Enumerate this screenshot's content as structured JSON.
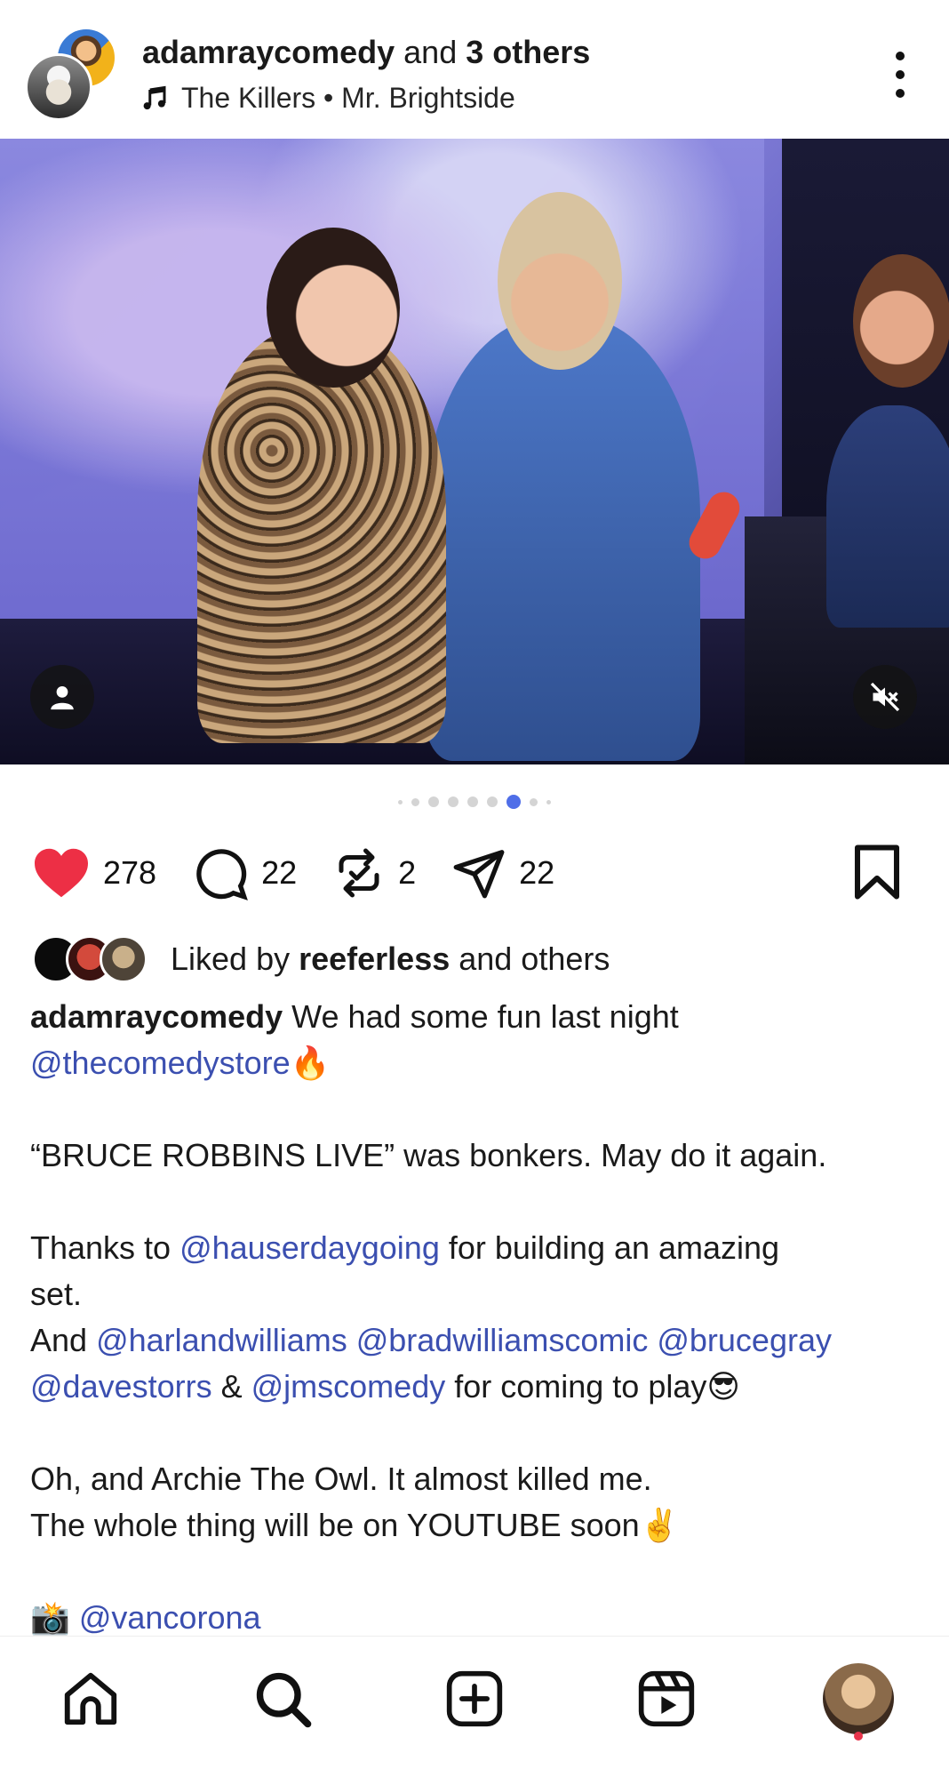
{
  "header": {
    "username": "adamraycomedy",
    "connector": " and ",
    "others": "3 others",
    "music_artist": "The Killers",
    "music_separator": " • ",
    "music_track": "Mr. Brightside"
  },
  "carousel": {
    "current_index": 6,
    "visible_dots": 9
  },
  "actions": {
    "likes_count": "278",
    "comments_count": "22",
    "reposts_count": "2",
    "shares_count": "22",
    "like_color": "#ed2f45"
  },
  "liked_by": {
    "prefix": "Liked by ",
    "user": "reeferless",
    "suffix": " and others"
  },
  "caption": {
    "user": "adamraycomedy",
    "line1_text": " We had some fun last night",
    "mention_store": "@thecomedystore",
    "emoji_fire": "🔥",
    "line_show": "“BRUCE ROBBINS LIVE” was bonkers. May do it again.",
    "thanks_prefix": "Thanks to ",
    "mention_hauser": "@hauserdaygoing",
    "thanks_suffix": " for building an amazing",
    "thanks_line2": "set.",
    "and_prefix": "And ",
    "mention_harland": "@harlandwilliams",
    "mention_brad": "@bradwilliamscomic",
    "mention_bruce": "@brucegray",
    "mention_dave": "@davestorrs",
    "amp": " & ",
    "mention_jms": "@jmscomedy",
    "play_suffix": " for coming to play",
    "emoji_cool": "😎",
    "owl_line": "Oh, and Archie The Owl. It almost killed me.",
    "youtube_line": "The whole thing will be on YOUTUBE soon",
    "emoji_peace": "✌️",
    "emoji_camera": "📸",
    "mention_van": "@vancorona"
  },
  "nav": {
    "items": [
      "home-icon",
      "search-icon",
      "create-icon",
      "reels-icon",
      "profile-avatar"
    ]
  },
  "colors": {
    "mention": "#3b4fb0",
    "active_dot": "#4f6ee8",
    "notification_dot": "#e8334a"
  }
}
